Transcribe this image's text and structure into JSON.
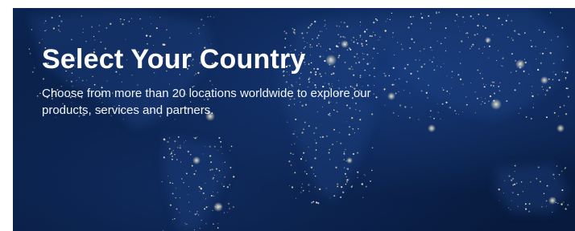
{
  "hero": {
    "title": "Select Your Country",
    "subtitle": "Choose from more than 20 locations worldwide to explore our products, services and partners.",
    "background_image": "world-map-city-lights",
    "colors": {
      "background": "#0a1f47",
      "text": "#ffffff"
    }
  }
}
